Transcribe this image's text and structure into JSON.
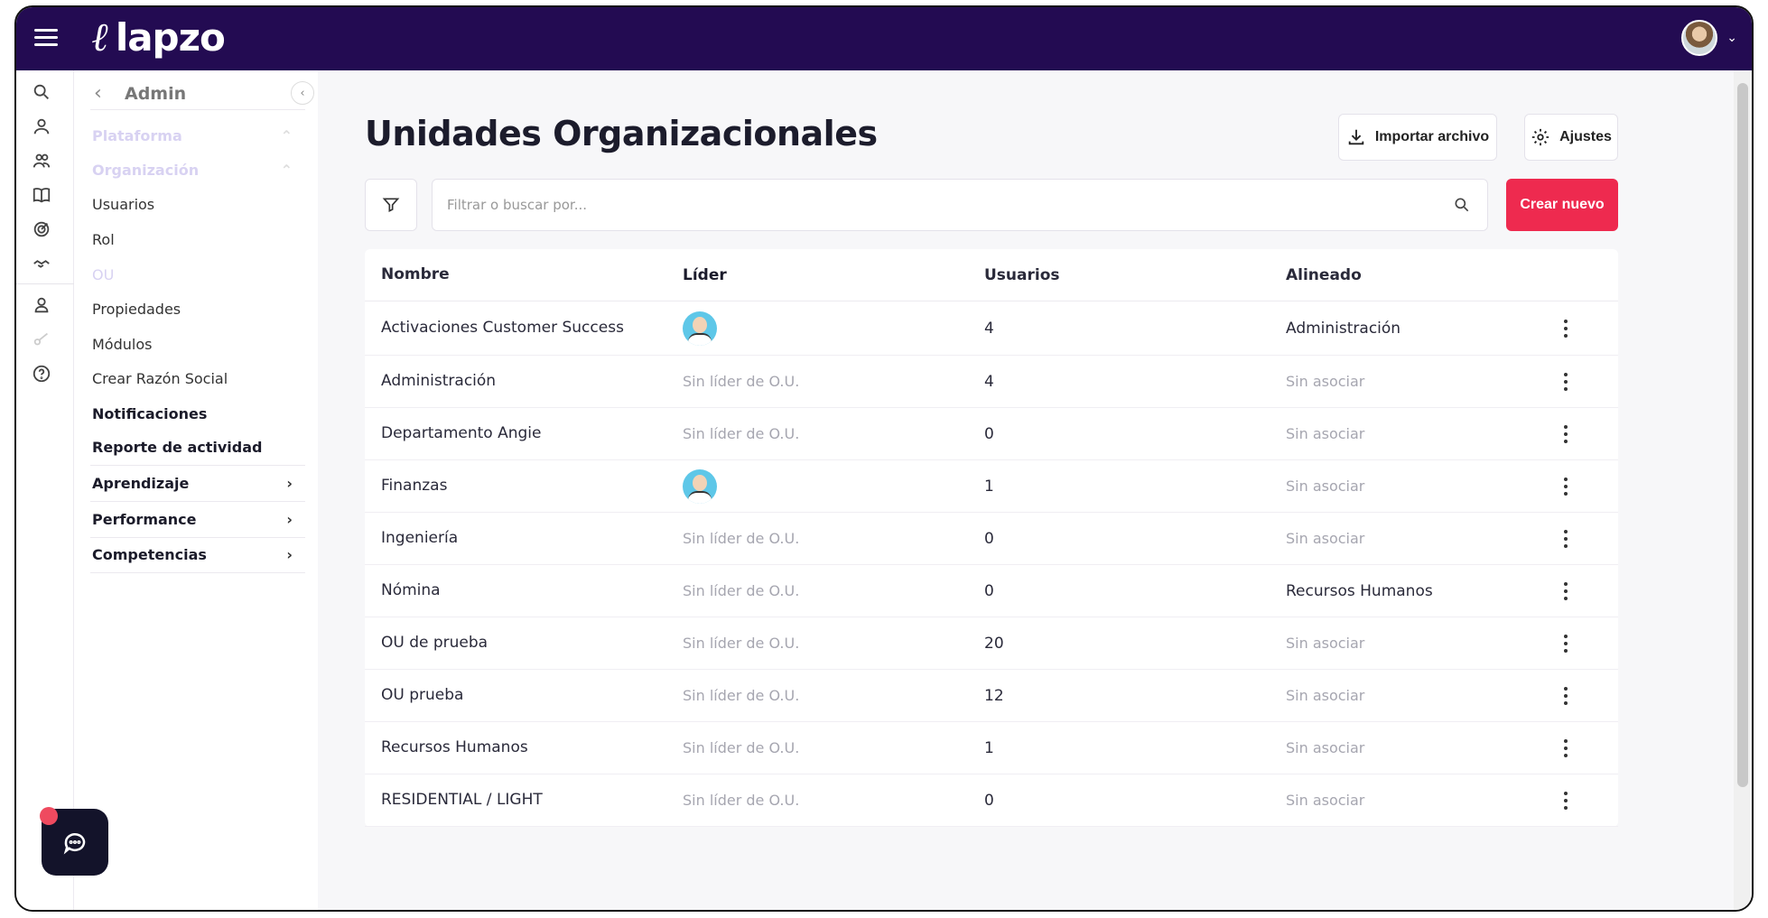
{
  "app": {
    "brand": "lapzo"
  },
  "sidebar": {
    "title": "Admin",
    "items": [
      {
        "label": "Plataforma"
      },
      {
        "label": "Organización"
      },
      {
        "label": "Usuarios"
      },
      {
        "label": "Rol"
      },
      {
        "label": "OU"
      },
      {
        "label": "Propiedades"
      },
      {
        "label": "Módulos"
      },
      {
        "label": "Crear Razón Social"
      },
      {
        "label": "Notificaciones"
      },
      {
        "label": "Reporte de actividad"
      },
      {
        "label": "Aprendizaje"
      },
      {
        "label": "Performance"
      },
      {
        "label": "Competencias"
      }
    ]
  },
  "main": {
    "title": "Unidades Organizacionales",
    "import_label": "Importar archivo",
    "settings_label": "Ajustes",
    "search_placeholder": "Filtrar o buscar por...",
    "create_label": "Crear nuevo"
  },
  "table": {
    "headers": [
      "Nombre",
      "Líder",
      "Usuarios",
      "Alineado"
    ],
    "rows": [
      {
        "name": "Activaciones Customer Success",
        "leader": "avatar",
        "users": "4",
        "aligned": "Administración"
      },
      {
        "name": "Administración",
        "leader": "Sin líder de O.U.",
        "users": "4",
        "aligned": "Sin asociar"
      },
      {
        "name": "Departamento Angie",
        "leader": "Sin líder de O.U.",
        "users": "0",
        "aligned": "Sin asociar"
      },
      {
        "name": "Finanzas",
        "leader": "avatar",
        "users": "1",
        "aligned": "Sin asociar"
      },
      {
        "name": "Ingeniería",
        "leader": "Sin líder de O.U.",
        "users": "0",
        "aligned": "Sin asociar"
      },
      {
        "name": "Nómina",
        "leader": "Sin líder de O.U.",
        "users": "0",
        "aligned": "Recursos Humanos"
      },
      {
        "name": "OU de prueba",
        "leader": "Sin líder de O.U.",
        "users": "20",
        "aligned": "Sin asociar"
      },
      {
        "name": "OU prueba",
        "leader": "Sin líder de O.U.",
        "users": "12",
        "aligned": "Sin asociar"
      },
      {
        "name": "Recursos Humanos",
        "leader": "Sin líder de O.U.",
        "users": "1",
        "aligned": "Sin asociar"
      },
      {
        "name": "RESIDENTIAL / LIGHT",
        "leader": "Sin líder de O.U.",
        "users": "0",
        "aligned": "Sin asociar"
      }
    ]
  },
  "colors": {
    "topbar": "#230b52",
    "accent": "#ee2a4f"
  }
}
